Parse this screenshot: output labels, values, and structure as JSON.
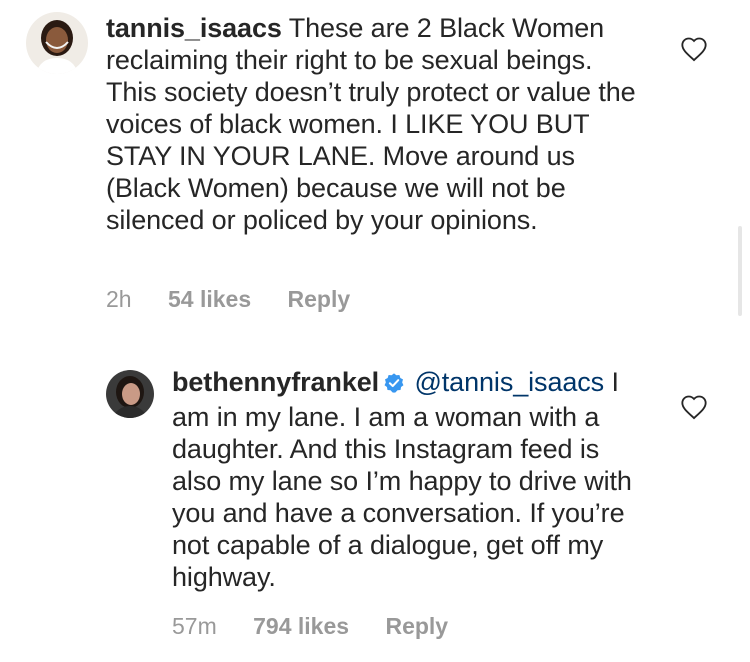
{
  "comments": [
    {
      "username": "tannis_isaacs",
      "text": "These are 2 Black Women reclaiming their right to be sexual beings. This society doesn’t truly protect or value the voices of black women. I LIKE YOU BUT STAY IN YOUR LANE. Move around us (Black Women) because we will not be silenced or policed by your opinions.",
      "time": "2h",
      "likes": "54 likes",
      "reply": "Reply"
    },
    {
      "username": "bethennyfrankel",
      "verified": true,
      "mention": "@tannis_isaacs",
      "text": "I am in my lane. I am a woman with a daughter. And this Instagram feed is also my lane so I’m happy to drive with you and have a conversation. If you’re not capable of a dialogue, get off my highway.",
      "time": "57m",
      "likes": "794 likes",
      "reply": "Reply"
    }
  ],
  "colors": {
    "text": "#262626",
    "meta": "#999999",
    "mention": "#003569",
    "verified": "#3897f0"
  },
  "icons": {
    "like": "heart-outline-icon",
    "verified": "verified-badge-icon"
  }
}
